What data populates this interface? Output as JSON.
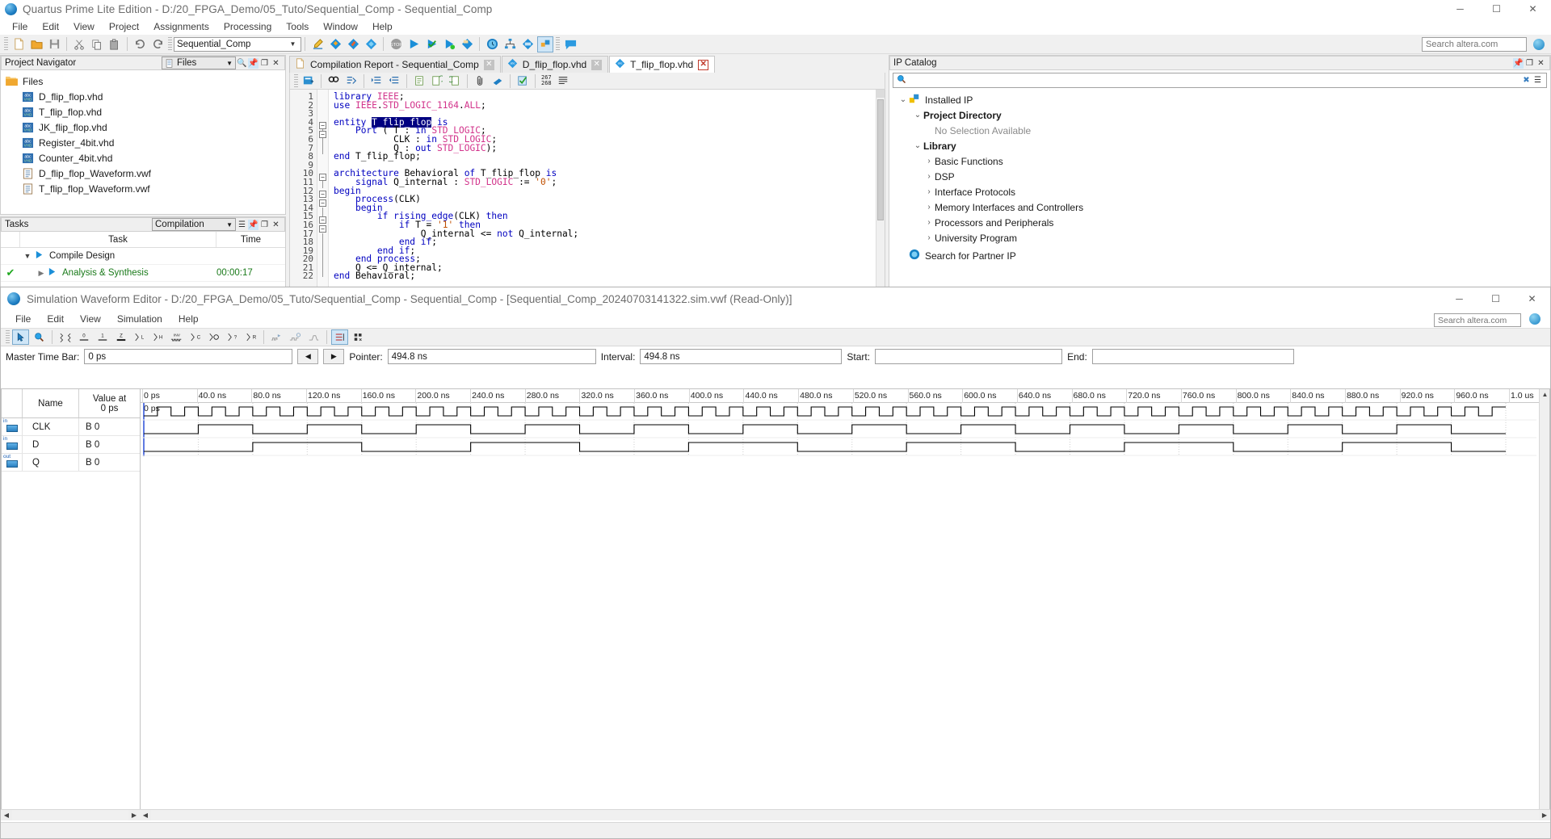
{
  "quartus": {
    "title": "Quartus Prime Lite Edition - D:/20_FPGA_Demo/05_Tuto/Sequential_Comp - Sequential_Comp",
    "logo_icon": "quartus-globe-icon",
    "window_buttons": {
      "minimize": "─",
      "maximize": "☐",
      "close": "✕"
    },
    "menu": [
      "File",
      "Edit",
      "View",
      "Project",
      "Assignments",
      "Processing",
      "Tools",
      "Window",
      "Help"
    ],
    "toolbar": {
      "project_combo": "Sequential_Comp",
      "search_placeholder": "Search altera.com"
    },
    "project_navigator": {
      "title": "Project Navigator",
      "view_selector": "Files",
      "root": "Files",
      "files": [
        {
          "name": "D_flip_flop.vhd",
          "icon": "vhdl-file-icon"
        },
        {
          "name": "T_flip_flop.vhd",
          "icon": "vhdl-file-icon"
        },
        {
          "name": "JK_flip_flop.vhd",
          "icon": "vhdl-file-icon"
        },
        {
          "name": "Register_4bit.vhd",
          "icon": "vhdl-file-icon"
        },
        {
          "name": "Counter_4bit.vhd",
          "icon": "vhdl-file-icon"
        },
        {
          "name": "D_flip_flop_Waveform.vwf",
          "icon": "waveform-file-icon"
        },
        {
          "name": "T_flip_flop_Waveform.vwf",
          "icon": "waveform-file-icon"
        }
      ]
    },
    "tasks": {
      "title": "Tasks",
      "flow_selector": "Compilation",
      "columns": [
        "Task",
        "Time"
      ],
      "rows": [
        {
          "status": "",
          "name": "Compile Design",
          "time": "",
          "indent": 0,
          "expanded": true
        },
        {
          "status": "check",
          "name": "Analysis & Synthesis",
          "time": "00:00:17",
          "indent": 1,
          "expanded": false
        }
      ]
    },
    "tabs": [
      {
        "label": "Compilation Report - Sequential_Comp",
        "icon": "report-icon",
        "active": false,
        "close": "✕",
        "close_style": "grey"
      },
      {
        "label": "D_flip_flop.vhd",
        "icon": "vhdl-file-icon",
        "active": false,
        "close": "✕",
        "close_style": "grey"
      },
      {
        "label": "T_flip_flop.vhd",
        "icon": "vhdl-file-icon",
        "active": true,
        "close": "✕",
        "close_style": "red"
      }
    ],
    "editor": {
      "selected_text": "T_flip_flop",
      "line_count": 22,
      "marker": "267\n268",
      "lines": [
        "library IEEE;",
        "use IEEE.STD_LOGIC_1164.ALL;",
        "",
        "entity T_flip_flop is",
        "    Port ( T : in STD_LOGIC;",
        "           CLK : in STD_LOGIC;",
        "           Q : out STD_LOGIC);",
        "end T_flip_flop;",
        "",
        "architecture Behavioral of T_flip_flop is",
        "    signal Q_internal : STD_LOGIC := '0';",
        "begin",
        "    process(CLK)",
        "    begin",
        "        if rising_edge(CLK) then",
        "            if T = '1' then",
        "                Q_internal <= not Q_internal;",
        "            end if;",
        "        end if;",
        "    end process;",
        "    Q <= Q_internal;",
        "end Behavioral;"
      ]
    },
    "ip_catalog": {
      "title": "IP Catalog",
      "search_placeholder": "",
      "search_icon": "search-icon",
      "nodes": [
        {
          "label": "Installed IP",
          "level": 0,
          "expanded": true,
          "icon": "installed-ip-icon",
          "bold": false
        },
        {
          "label": "Project Directory",
          "level": 1,
          "expanded": true,
          "bold": true
        },
        {
          "label": "No Selection Available",
          "level": 2,
          "expanded": null,
          "muted": true
        },
        {
          "label": "Library",
          "level": 1,
          "expanded": true,
          "bold": true
        },
        {
          "label": "Basic Functions",
          "level": 2,
          "expanded": false
        },
        {
          "label": "DSP",
          "level": 2,
          "expanded": false
        },
        {
          "label": "Interface Protocols",
          "level": 2,
          "expanded": false
        },
        {
          "label": "Memory Interfaces and Controllers",
          "level": 2,
          "expanded": false
        },
        {
          "label": "Processors and Peripherals",
          "level": 2,
          "expanded": false
        },
        {
          "label": "University Program",
          "level": 2,
          "expanded": false
        },
        {
          "label": "Search for Partner IP",
          "level": 0,
          "expanded": null,
          "icon": "partner-ip-icon"
        }
      ]
    }
  },
  "waveform_editor": {
    "title": "Simulation Waveform Editor - D:/20_FPGA_Demo/05_Tuto/Sequential_Comp - Sequential_Comp - [Sequential_Comp_20240703141322.sim.vwf (Read-Only)]",
    "logo_icon": "quartus-globe-icon",
    "window_buttons": {
      "minimize": "─",
      "maximize": "☐",
      "close": "✕"
    },
    "menu": [
      "File",
      "Edit",
      "View",
      "Simulation",
      "Help"
    ],
    "search_placeholder": "Search altera.com",
    "toolbar_icons": [
      "select-arrow-icon",
      "zoom-icon",
      "waveform-random-icon",
      "force-0-icon",
      "force-1-icon",
      "force-z-icon",
      "count-low-icon",
      "count-high-icon",
      "invert-icon",
      "clock-c-icon",
      "count-value-icon",
      "unknown-x-icon",
      "random-r-icon",
      "overwrite-clock-icon",
      "overwrite-count-icon",
      "stretch-icon",
      "snap-grid-icon",
      "grid-size-icon"
    ],
    "fields": {
      "master_time_bar_label": "Master Time Bar:",
      "master_time_bar_value": "0 ps",
      "prev_button": "◀",
      "next_button": "▶",
      "pointer_label": "Pointer:",
      "pointer_value": "494.8 ns",
      "interval_label": "Interval:",
      "interval_value": "494.8 ns",
      "start_label": "Start:",
      "start_value": "",
      "end_label": "End:",
      "end_value": ""
    },
    "signal_table": {
      "columns": [
        "Name",
        "Value at 0 ps"
      ],
      "value_header_line1": "Value at",
      "value_header_line2": "0 ps",
      "rows": [
        {
          "direction": "in",
          "name": "CLK",
          "value": "B 0"
        },
        {
          "direction": "in",
          "name": "D",
          "value": "B 0"
        },
        {
          "direction": "out",
          "name": "Q",
          "value": "B 0"
        }
      ]
    },
    "ruler": {
      "origin_label": "0 ps",
      "ticks": [
        "0 ps",
        "40.0 ns",
        "80.0 ns",
        "120.0 ns",
        "160.0 ns",
        "200.0 ns",
        "240.0 ns",
        "280.0 ns",
        "320.0 ns",
        "360.0 ns",
        "400.0 ns",
        "440.0 ns",
        "480.0 ns",
        "520.0 ns",
        "560.0 ns",
        "600.0 ns",
        "640.0 ns",
        "680.0 ns",
        "720.0 ns",
        "760.0 ns",
        "800.0 ns",
        "840.0 ns",
        "880.0 ns",
        "920.0 ns",
        "960.0 ns",
        "1.0 us"
      ]
    },
    "waveforms": {
      "time_end_ns": 1000,
      "signals": [
        {
          "name": "CLK",
          "period_ns": 20,
          "duty": 0.5,
          "start_high": false,
          "phase_ns": 0
        },
        {
          "name": "D",
          "period_ns": 80,
          "duty": 0.5,
          "start_high": false,
          "phase_ns": 0
        },
        {
          "name": "Q",
          "period_ns": 160,
          "duty": 0.5,
          "start_high": false,
          "phase_ns": 0
        }
      ]
    },
    "status": ""
  },
  "colors": {
    "accent": "#1782c4",
    "selection": "#000080",
    "keyword": "#0000c0",
    "type": "#d2338b",
    "string": "#c05000",
    "success": "#1fa81f",
    "tab_close_red": "#c0392b"
  }
}
